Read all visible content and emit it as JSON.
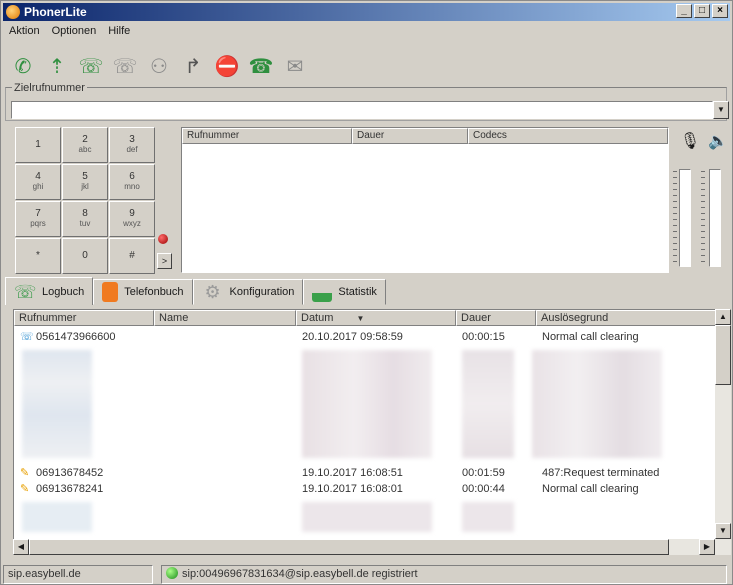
{
  "window": {
    "title": "PhonerLite",
    "minimize": "_",
    "maximize": "□",
    "close": "×"
  },
  "menu": [
    "Aktion",
    "Optionen",
    "Hilfe"
  ],
  "toolbar": {
    "icons": [
      "phone-call-icon",
      "forward-icon",
      "transfer-icon",
      "hold-icon",
      "conference-icon",
      "redirect-icon",
      "dnd-icon",
      "callback-icon",
      "voicemail-icon"
    ]
  },
  "target": {
    "legend": "Zielrufnummer",
    "value": "",
    "dropdown": "▼"
  },
  "keypad": [
    {
      "digit": "1",
      "letters": ""
    },
    {
      "digit": "2",
      "letters": "abc"
    },
    {
      "digit": "3",
      "letters": "def"
    },
    {
      "digit": "4",
      "letters": "ghi"
    },
    {
      "digit": "5",
      "letters": "jkl"
    },
    {
      "digit": "6",
      "letters": "mno"
    },
    {
      "digit": "7",
      "letters": "pqrs"
    },
    {
      "digit": "8",
      "letters": "tuv"
    },
    {
      "digit": "9",
      "letters": "wxyz"
    },
    {
      "digit": "*",
      "letters": ""
    },
    {
      "digit": "0",
      "letters": ""
    },
    {
      "digit": "#",
      "letters": ""
    }
  ],
  "active_calls": {
    "columns": [
      "Rufnummer",
      "Dauer",
      "Codecs"
    ]
  },
  "tabs": [
    {
      "label": "Logbuch",
      "icon": "logbook-icon",
      "color": "#3a9a4a"
    },
    {
      "label": "Telefonbuch",
      "icon": "phonebook-icon",
      "color": "#f07a20"
    },
    {
      "label": "Konfiguration",
      "icon": "config-icon",
      "color": "#9a9a9a"
    },
    {
      "label": "Statistik",
      "icon": "statistics-icon",
      "color": "#3aa04a"
    }
  ],
  "log": {
    "columns": [
      "Rufnummer",
      "Name",
      "Datum",
      "Dauer",
      "Auslösegrund"
    ],
    "sort_marker": "▼",
    "rows": [
      {
        "number": "0561473966600",
        "name": "",
        "date": "20.10.2017 09:58:59",
        "duration": "00:00:15",
        "reason": "Normal call clearing",
        "icon_color": "#2f8fd0"
      },
      {
        "number": "06913678452",
        "name": "",
        "date": "19.10.2017 16:08:51",
        "duration": "00:01:59",
        "reason": "487:Request terminated",
        "icon_color": "#e8a000"
      },
      {
        "number": "06913678241",
        "name": "",
        "date": "19.10.2017 16:08:01",
        "duration": "00:00:44",
        "reason": "Normal call clearing",
        "icon_color": "#e8a000"
      }
    ]
  },
  "status": {
    "server": "sip.easybell.de",
    "registration": "sip:00496967831634@sip.easybell.de registriert"
  }
}
